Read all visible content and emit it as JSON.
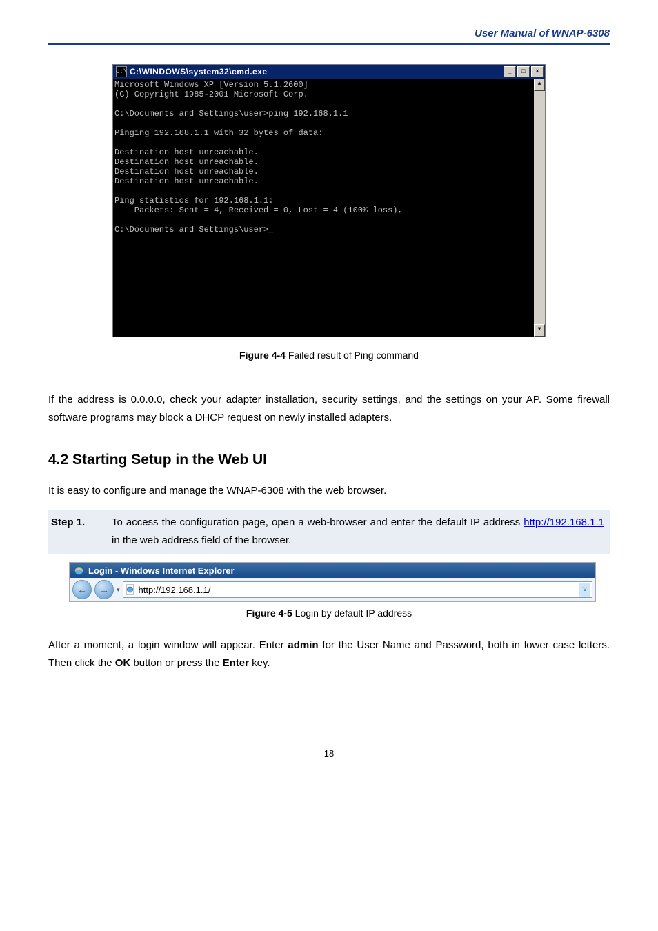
{
  "header": {
    "title": "User Manual of WNAP-6308"
  },
  "cmd": {
    "title": "C:\\WINDOWS\\system32\\cmd.exe",
    "icon_label": "cmd-icon",
    "minimize": "_",
    "maximize": "□",
    "close": "×",
    "scroll_up": "▲",
    "scroll_down": "▼",
    "content": "Microsoft Windows XP [Version 5.1.2600]\n(C) Copyright 1985-2001 Microsoft Corp.\n\nC:\\Documents and Settings\\user>ping 192.168.1.1\n\nPinging 192.168.1.1 with 32 bytes of data:\n\nDestination host unreachable.\nDestination host unreachable.\nDestination host unreachable.\nDestination host unreachable.\n\nPing statistics for 192.168.1.1:\n    Packets: Sent = 4, Received = 0, Lost = 4 (100% loss),\n\nC:\\Documents and Settings\\user>_"
  },
  "figcap1": {
    "bold": "Figure 4-4",
    "rest": " Failed result of Ping command"
  },
  "para1": "If the address is 0.0.0.0, check your adapter installation, security settings, and the settings on your AP. Some firewall software programs may block a DHCP request on newly installed adapters.",
  "section": {
    "title": "4.2  Starting Setup in the Web UI"
  },
  "para2": "It is easy to configure and manage the WNAP-6308 with the web browser.",
  "step1": {
    "label": "Step 1.",
    "pre": "To access the configuration page, open a web-browser and enter the default IP address ",
    "url": "http://192.168.1.1",
    "post": " in the web address field of the browser."
  },
  "ie": {
    "title": "Login - Windows Internet Explorer",
    "back": "←",
    "forward": "→",
    "dropdown": "▾",
    "addr_value": "http://192.168.1.1/",
    "addr_dd": "v"
  },
  "figcap2": {
    "bold": "Figure 4-5",
    "rest": " Login by default IP address"
  },
  "para3_pre": "After a moment, a login window will appear. Enter ",
  "para3_b1": "admin",
  "para3_mid": " for the User Name and Password, both in lower case letters. Then click the ",
  "para3_b2": "OK",
  "para3_mid2": " button or press the ",
  "para3_b3": "Enter",
  "para3_post": " key.",
  "footer": {
    "page": "-18-"
  }
}
